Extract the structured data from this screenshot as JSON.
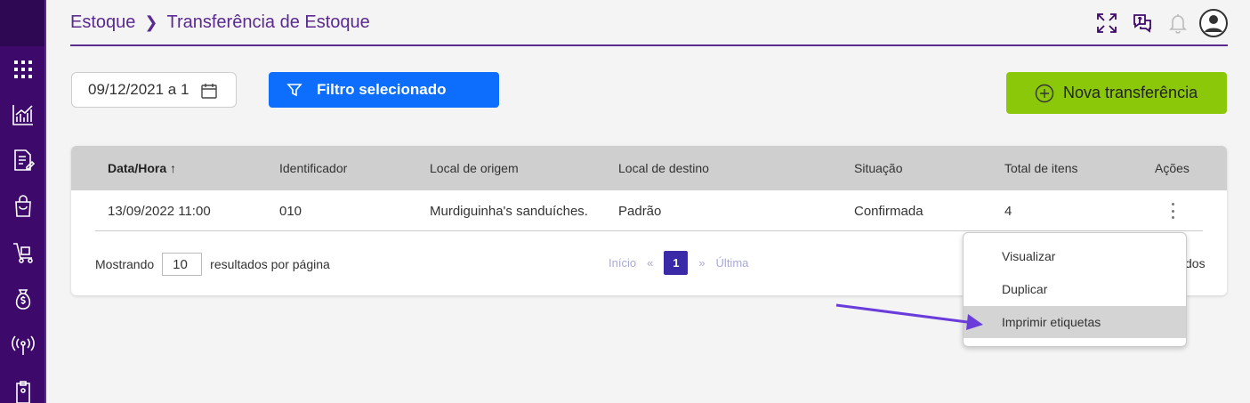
{
  "breadcrumb": {
    "root": "Estoque",
    "current": "Transferência de Estoque"
  },
  "header_icons": [
    "fullscreen-icon",
    "help-icon",
    "bell-icon",
    "user-avatar-icon"
  ],
  "sidebar": {
    "items": [
      "grid-icon",
      "chart-icon",
      "document-edit-icon",
      "shopping-bag-icon",
      "hand-truck-icon",
      "money-bag-icon",
      "signal-icon",
      "clipboard-icon"
    ]
  },
  "toolbar": {
    "date_range": "09/12/2021 a 1",
    "filter_label": "Filtro selecionado",
    "new_label": "Nova transferência"
  },
  "table": {
    "headers": [
      "Data/Hora",
      "Identificador",
      "Local de origem",
      "Local de destino",
      "Situação",
      "Total de itens",
      "Ações"
    ],
    "sort_indicator": "↑",
    "rows": [
      [
        "13/09/2022 11:00",
        "010",
        "Murdiguinha's sanduíches.",
        "Padrão",
        "Confirmada",
        "4"
      ]
    ]
  },
  "pagination": {
    "showing_label": "Mostrando",
    "per_page": "10",
    "per_page_suffix": "resultados por página",
    "first": "Início",
    "prev": "«",
    "current": "1",
    "next": "»",
    "last": "Última",
    "right_partial": "dos"
  },
  "action_menu": {
    "items": [
      "Visualizar",
      "Duplicar",
      "Imprimir etiquetas"
    ],
    "highlighted_index": 2
  },
  "colors": {
    "sidebar": "#3d0a6b",
    "brand_purple": "#5a2a90",
    "filter_blue": "#0d6efd",
    "new_green": "#8bc80a",
    "page_active": "#3a2aa8",
    "arrow": "#6a3ddb"
  }
}
